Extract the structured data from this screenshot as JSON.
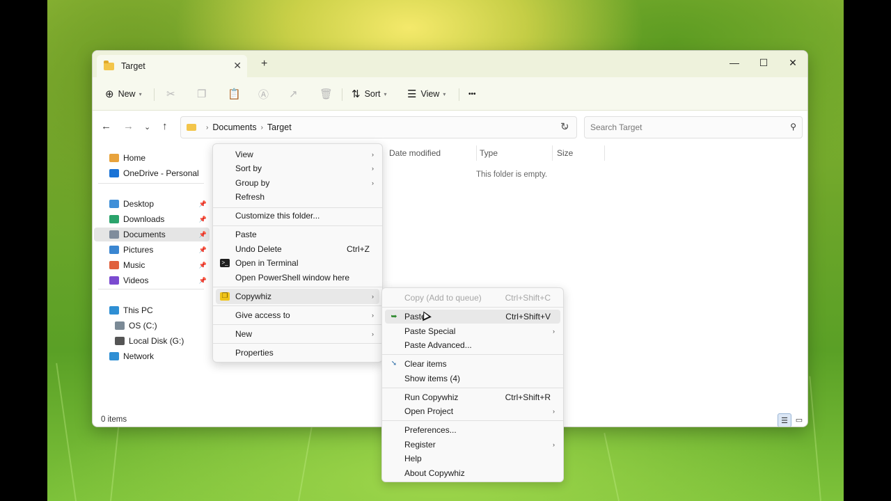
{
  "window": {
    "tab_title": "Target",
    "new_tab": "+",
    "controls": {
      "minimize": "—",
      "maximize": "☐",
      "close": "✕"
    }
  },
  "toolbar": {
    "new_label": "New",
    "sort_label": "Sort",
    "view_label": "View",
    "more": "•••"
  },
  "address": {
    "crumbs": [
      "Documents",
      "Target"
    ],
    "search_placeholder": "Search Target"
  },
  "sidebar": {
    "top": [
      {
        "label": "Home",
        "icon": "home-icon",
        "color": "#e8a33c"
      },
      {
        "label": "OneDrive - Personal",
        "icon": "cloud-icon",
        "color": "#1a73d6"
      }
    ],
    "quick": [
      {
        "label": "Desktop",
        "icon": "desktop-icon",
        "color": "#3f8fd8"
      },
      {
        "label": "Downloads",
        "icon": "download-icon",
        "color": "#2aa36b"
      },
      {
        "label": "Documents",
        "icon": "documents-icon",
        "color": "#7f8c9c"
      },
      {
        "label": "Pictures",
        "icon": "pictures-icon",
        "color": "#3a86d1"
      },
      {
        "label": "Music",
        "icon": "music-icon",
        "color": "#e0603c"
      },
      {
        "label": "Videos",
        "icon": "videos-icon",
        "color": "#7b4bd0"
      }
    ],
    "devices": [
      {
        "label": "This PC",
        "icon": "computer-icon",
        "color": "#2f8fd4"
      },
      {
        "label": "OS (C:)",
        "icon": "drive-icon",
        "color": "#7b8a96"
      },
      {
        "label": "Local Disk (G:)",
        "icon": "drive-icon",
        "color": "#555555"
      },
      {
        "label": "Network",
        "icon": "network-icon",
        "color": "#2f8fd4"
      }
    ]
  },
  "content": {
    "columns": [
      "Date modified",
      "Type",
      "Size"
    ],
    "empty_text": "This folder is empty."
  },
  "status": {
    "count": "0 items"
  },
  "context_menu": {
    "group1": [
      {
        "label": "View",
        "submenu": true
      },
      {
        "label": "Sort by",
        "submenu": true
      },
      {
        "label": "Group by",
        "submenu": true
      },
      {
        "label": "Refresh",
        "submenu": false
      }
    ],
    "group2": [
      {
        "label": "Customize this folder..."
      }
    ],
    "group3": [
      {
        "label": "Paste",
        "shortcut": ""
      },
      {
        "label": "Undo Delete",
        "shortcut": "Ctrl+Z"
      },
      {
        "label": "Open in Terminal",
        "shortcut": ""
      },
      {
        "label": "Open PowerShell window here",
        "shortcut": ""
      }
    ],
    "copywhiz": "Copywhiz",
    "give_access": "Give access to",
    "new": "New",
    "properties": "Properties"
  },
  "submenu": {
    "group1": [
      {
        "label": "Copy (Add to queue)",
        "shortcut": "Ctrl+Shift+C"
      }
    ],
    "group2": [
      {
        "label": "Paste",
        "shortcut": "Ctrl+Shift+V"
      },
      {
        "label": "Paste Special",
        "shortcut": ""
      },
      {
        "label": "Paste Advanced...",
        "shortcut": ""
      }
    ],
    "group3": [
      {
        "label": "Clear items"
      },
      {
        "label": "Show items (4)"
      }
    ],
    "group4": [
      {
        "label": "Run Copywhiz",
        "shortcut": "Ctrl+Shift+R"
      },
      {
        "label": "Open Project",
        "shortcut": ""
      }
    ],
    "group5": [
      {
        "label": "Preferences..."
      },
      {
        "label": "Register"
      },
      {
        "label": "Help"
      },
      {
        "label": "About Copywhiz"
      }
    ]
  }
}
